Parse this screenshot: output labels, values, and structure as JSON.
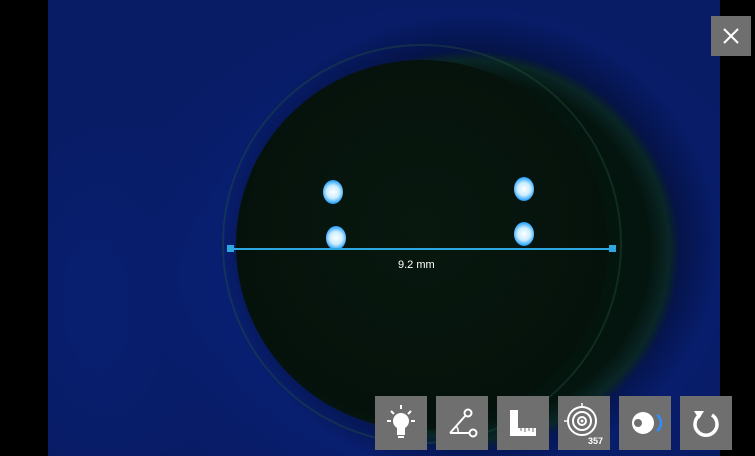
{
  "viewer": {
    "measurement": {
      "value_label": "9.2 mm",
      "color": "#2ea6e0"
    }
  },
  "close_button": {
    "icon": "close-icon"
  },
  "toolbar": {
    "buttons": [
      {
        "name": "illumination-button",
        "icon": "lightbulb-icon"
      },
      {
        "name": "angle-measure-button",
        "icon": "angle-icon"
      },
      {
        "name": "ruler-button",
        "icon": "ruler-icon"
      },
      {
        "name": "target-button",
        "icon": "target-icon",
        "badge": "357"
      },
      {
        "name": "view-eye-button",
        "icon": "eye-view-icon"
      },
      {
        "name": "reset-button",
        "icon": "refresh-icon"
      }
    ],
    "background": "#6f6f6f"
  }
}
